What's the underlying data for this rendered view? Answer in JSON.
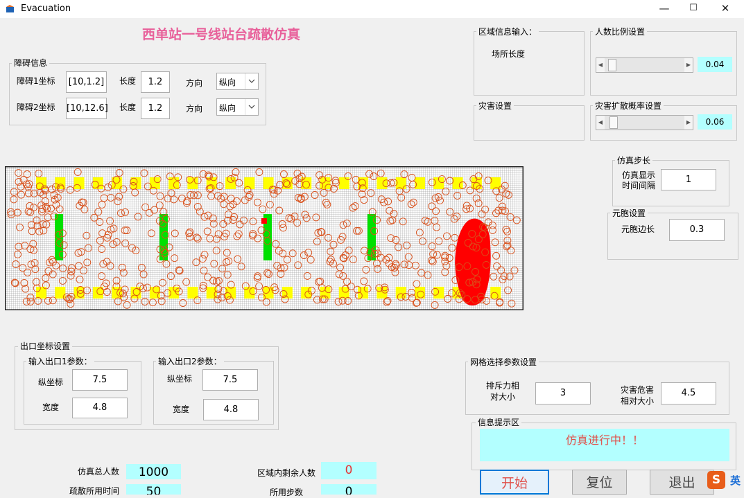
{
  "window": {
    "title": "Evacuation",
    "controls": {
      "minimize": "—",
      "maximize": "☐",
      "close": "✕"
    }
  },
  "heading": "西单站一号线站台疏散仿真",
  "obstacle_panel": {
    "title": "障碍信息",
    "rows": [
      {
        "coord_label": "障碍1坐标",
        "coord_value": "[10,1.2]",
        "length_label": "长度",
        "length_value": "1.2",
        "dir_label": "方向",
        "dir_value": "纵向"
      },
      {
        "coord_label": "障碍2坐标",
        "coord_value": "[10,12.6]",
        "length_label": "长度",
        "length_value": "1.2",
        "dir_label": "方向",
        "dir_value": "纵向"
      }
    ]
  },
  "region_panel": {
    "title": "区域信息输入：",
    "field_label": "场所长度"
  },
  "ratio_panel": {
    "title": "人数比例设置",
    "value": "0.04",
    "level": 0.04
  },
  "disaster_panel": {
    "title": "灾害设置"
  },
  "spread_panel": {
    "title": "灾害扩散概率设置",
    "value": "0.06",
    "level": 0.06
  },
  "step_panel": {
    "title": "仿真步长",
    "label": "仿真显示\n时间间隔",
    "value": "1"
  },
  "cell_panel": {
    "title": "元胞设置",
    "label": "元胞边长",
    "value": "0.3"
  },
  "exit_panel": {
    "title": "出口坐标设置",
    "exits": [
      {
        "title": "输入出口1参数：",
        "y_label": "纵坐标",
        "y_value": "7.5",
        "w_label": "宽度",
        "w_value": "4.8"
      },
      {
        "title": "输入出口2参数：",
        "y_label": "纵坐标",
        "y_value": "7.5",
        "w_label": "宽度",
        "w_value": "4.8"
      }
    ]
  },
  "grid_panel": {
    "title": "网格选择参数设置",
    "repulsion_label": "排斥力相\n对大小",
    "repulsion_value": "3",
    "hazard_label": "灾害危害\n相对大小",
    "hazard_value": "4.5"
  },
  "info_panel": {
    "title": "信息提示区",
    "message": "仿真进行中！！"
  },
  "stats": {
    "total_label": "仿真总人数",
    "total_value": "1000",
    "remaining_label": "区域内剩余人数",
    "remaining_value": "0",
    "time_label": "疏散所用时间",
    "time_value": "50",
    "steps_label": "所用步数",
    "steps_value": "0"
  },
  "buttons": {
    "start": "开始",
    "reset": "复位",
    "exit": "退出"
  },
  "ime": {
    "letter": "S",
    "lang": "英"
  },
  "colors": {
    "heading": "#e8609a",
    "agent": "#d9501a",
    "obstacle": "#00e000",
    "fire": "#ff0000",
    "exit_marker": "#ffff00",
    "info_bg": "#b3ffff",
    "info_text": "#e0504a"
  }
}
